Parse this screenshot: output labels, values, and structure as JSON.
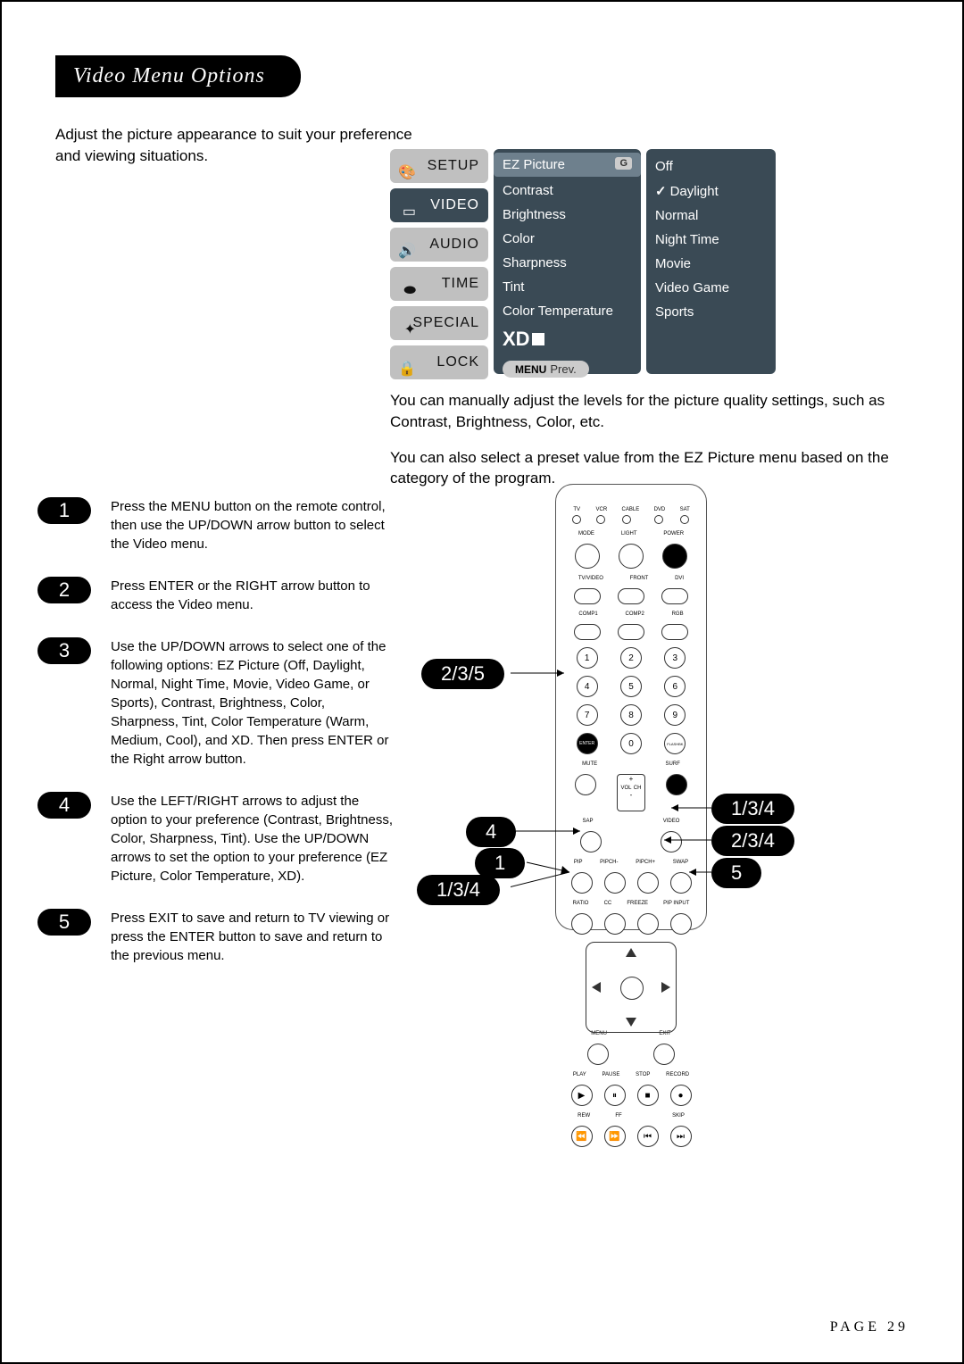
{
  "title": "Video Menu Options",
  "intro": "Adjust the picture appearance to suit your preference and viewing situations.",
  "menu_tabs": [
    "SETUP",
    "VIDEO",
    "AUDIO",
    "TIME",
    "SPECIAL",
    "LOCK"
  ],
  "active_tab": "VIDEO",
  "panel1": {
    "highlight": "EZ Picture",
    "highlight_flag": "G",
    "items": [
      "Contrast",
      "Brightness",
      "Color",
      "Sharpness",
      "Tint",
      "Color Temperature"
    ],
    "xd_label": "XD",
    "prev_button": "MENU",
    "prev_label": "Prev."
  },
  "panel2": {
    "items": [
      "Off",
      "Daylight",
      "Normal",
      "Night Time",
      "Movie",
      "Video Game",
      "Sports"
    ],
    "checked": "Daylight"
  },
  "desc": {
    "p1": "You can manually adjust the levels for the picture quality settings, such as Contrast, Brightness, Color, etc.",
    "p2": "You can also select a preset value from the EZ Picture menu based on the category of the program."
  },
  "steps": [
    {
      "n": "1",
      "t": "Press the MENU button on the remote control, then use the UP/DOWN arrow button to select the Video menu."
    },
    {
      "n": "2",
      "t": "Press ENTER or the RIGHT arrow button to access the Video menu."
    },
    {
      "n": "3",
      "t": "Use the UP/DOWN arrows to select one of the following options: EZ Picture (Off, Daylight, Normal, Night Time, Movie, Video Game, or Sports), Contrast, Brightness, Color, Sharpness, Tint, Color Temperature (Warm, Medium, Cool), and XD. Then press ENTER or the Right arrow button."
    },
    {
      "n": "4",
      "t": "Use the LEFT/RIGHT arrows to adjust the option to your preference (Contrast, Brightness, Color, Sharpness, Tint). Use the UP/DOWN arrows to set the option to your preference (EZ Picture, Color Temperature, XD)."
    },
    {
      "n": "5",
      "t": "Press EXIT to save and return to TV viewing or press the ENTER button to save and return to the previous menu."
    }
  ],
  "remote": {
    "top_leds": [
      "TV",
      "VCR",
      "CABLE",
      "DVD",
      "SAT"
    ],
    "row2_labels": [
      "MODE",
      "LIGHT",
      "POWER"
    ],
    "row3_labels": [
      "TV/VIDEO",
      "FRONT",
      "DVI"
    ],
    "row4_labels": [
      "COMP1",
      "COMP2",
      "RGB"
    ],
    "numpad": [
      "1",
      "2",
      "3",
      "4",
      "5",
      "6",
      "7",
      "8",
      "9"
    ],
    "enter_label": "ENTER",
    "zero_label": "0",
    "flashbk_label": "FLASHBK",
    "mute_label": "MUTE",
    "surf_label": "SURF",
    "sap_label": "SAP",
    "video_label": "VIDEO",
    "vol_label": "VOL",
    "ch_label": "CH",
    "pip_row": [
      "PIP",
      "PIPCH-",
      "PIPCH+",
      "SWAP"
    ],
    "util_row": [
      "RATIO",
      "CC",
      "FREEZE",
      "PIP INPUT"
    ],
    "menu_label": "MENU",
    "exit_label": "EXIT",
    "transport_row1": [
      "PLAY",
      "PAUSE",
      "STOP",
      "RECORD"
    ],
    "transport_row2": [
      "REW",
      "FF",
      "",
      "SKIP"
    ]
  },
  "callouts": {
    "enter": "2/3/5",
    "left": "4",
    "up_right": "1/3/4",
    "right": "2/3/4",
    "exit": "5",
    "menu": "1",
    "menu_below": "1/3/4"
  },
  "footer": "PAGE 29"
}
